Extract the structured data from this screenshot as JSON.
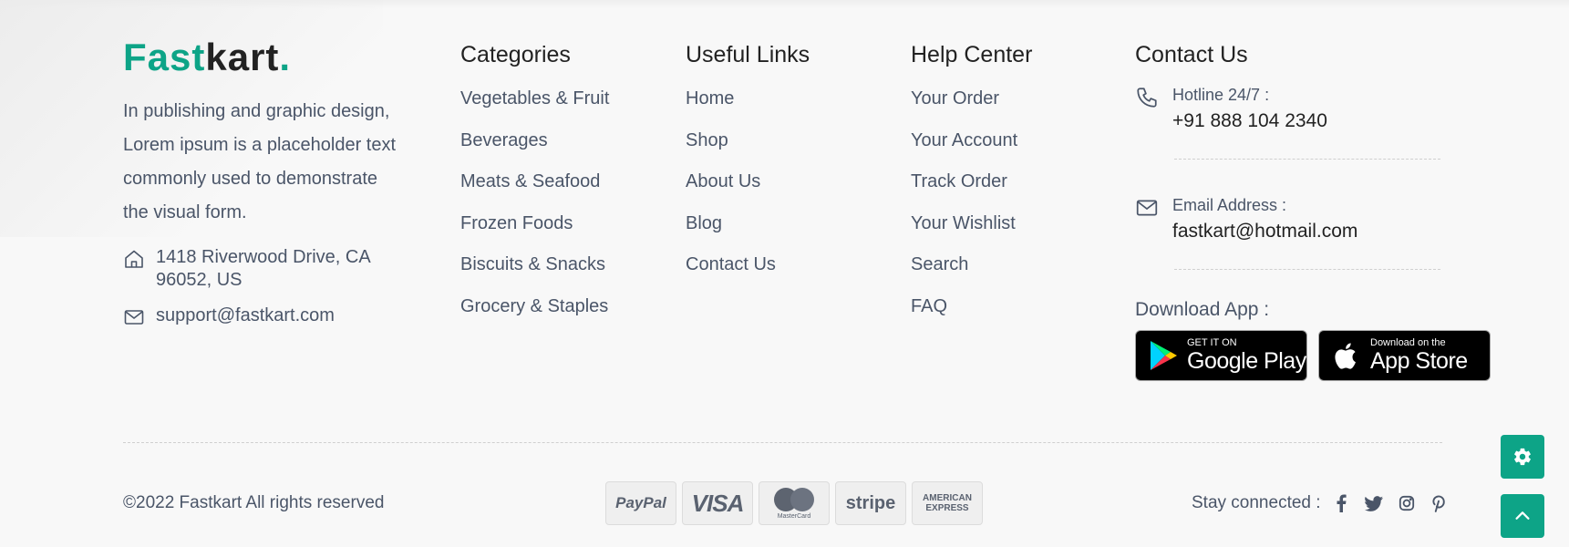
{
  "brand": {
    "part1": "Fast",
    "part2": "kart",
    "dot": ".",
    "color": "#0da487"
  },
  "about": {
    "text": "In publishing and graphic design, Lorem ipsum is a placeholder text commonly used to demonstrate the visual form.",
    "address": "1418 Riverwood Drive, CA 96052, US",
    "email": "support@fastkart.com"
  },
  "categories": {
    "title": "Categories",
    "items": [
      "Vegetables & Fruit",
      "Beverages",
      "Meats & Seafood",
      "Frozen Foods",
      "Biscuits & Snacks",
      "Grocery & Staples"
    ]
  },
  "useful_links": {
    "title": "Useful Links",
    "items": [
      "Home",
      "Shop",
      "About Us",
      "Blog",
      "Contact Us"
    ]
  },
  "help_center": {
    "title": "Help Center",
    "items": [
      "Your Order",
      "Your Account",
      "Track Order",
      "Your Wishlist",
      "Search",
      "FAQ"
    ]
  },
  "contact": {
    "title": "Contact Us",
    "hotline_label": "Hotline 24/7 :",
    "hotline_value": "+91 888 104 2340",
    "email_label": "Email Address :",
    "email_value": "fastkart@hotmail.com",
    "download_title": "Download App :",
    "google_small": "GET IT ON",
    "google_big": "Google Play",
    "apple_small": "Download on the",
    "apple_big": "App Store"
  },
  "bottom": {
    "copyright": "©2022 Fastkart All rights reserved",
    "payments": {
      "paypal": "PayPal",
      "visa": "VISA",
      "mastercard": "MasterCard",
      "stripe": "stripe",
      "amex_1": "AMERICAN",
      "amex_2": "EXPRESS"
    },
    "stay_connected": "Stay connected :",
    "social_icons": [
      "facebook-icon",
      "twitter-icon",
      "instagram-icon",
      "pinterest-icon"
    ]
  },
  "floating": {
    "settings_icon": "gear-icon",
    "top_icon": "chevron-up-icon"
  }
}
